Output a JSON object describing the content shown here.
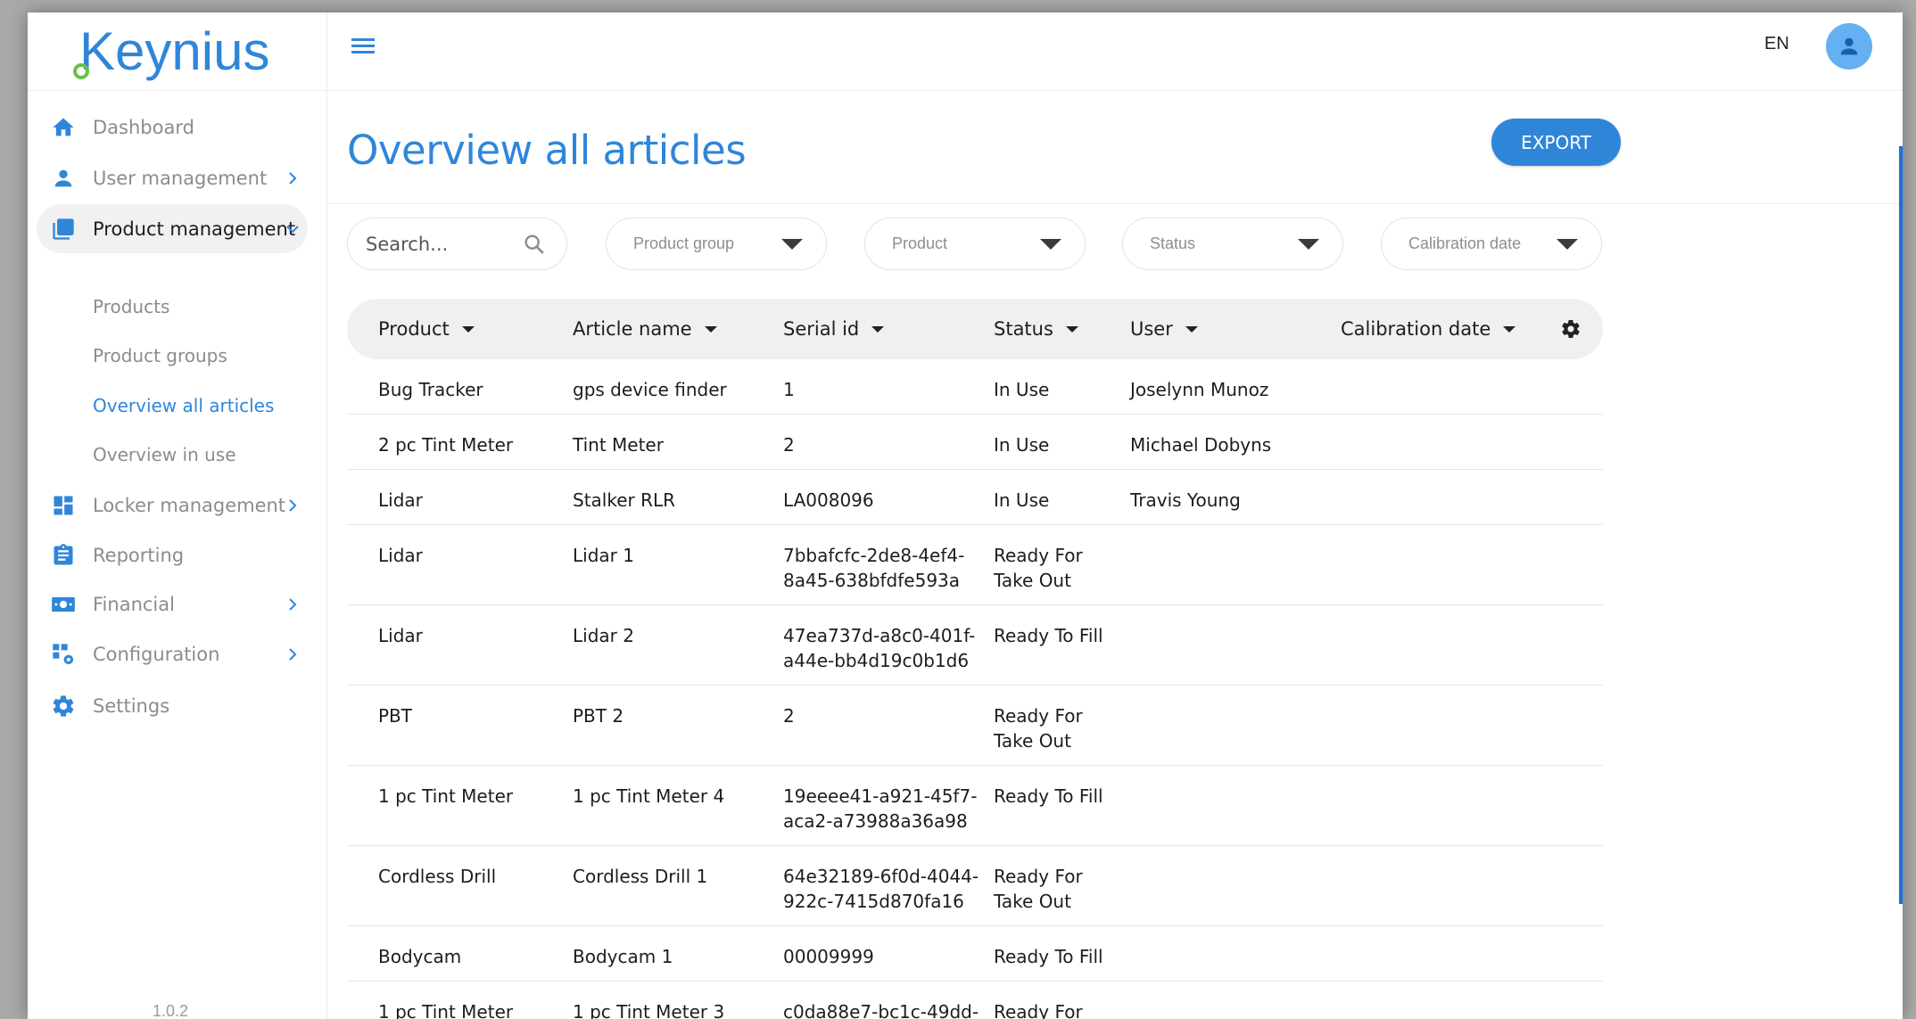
{
  "brand": {
    "logo_text": "Keynius",
    "colors": {
      "primary": "#2f86d9",
      "accent_green": "#6cc04a"
    }
  },
  "sidebar": {
    "items": [
      {
        "label": "Dashboard",
        "icon": "home-icon",
        "chevron": false
      },
      {
        "label": "User management",
        "icon": "user-icon",
        "chevron": true
      },
      {
        "label": "Product management",
        "icon": "library-icon",
        "chevron": true,
        "expanded": true
      },
      {
        "label": "Locker management",
        "icon": "grid-icon",
        "chevron": true
      },
      {
        "label": "Reporting",
        "icon": "clipboard-icon",
        "chevron": false
      },
      {
        "label": "Financial",
        "icon": "money-icon",
        "chevron": true
      },
      {
        "label": "Configuration",
        "icon": "config-icon",
        "chevron": true
      },
      {
        "label": "Settings",
        "icon": "gear-icon",
        "chevron": false
      }
    ],
    "sub_items": [
      "Products",
      "Product groups",
      "Overview all articles",
      "Overview in use"
    ],
    "version": "1.0.2"
  },
  "topbar": {
    "language": "EN"
  },
  "header": {
    "title": "Overview all articles",
    "export_label": "EXPORT"
  },
  "filters": {
    "search_placeholder": "Search...",
    "product_group": "Product group",
    "product": "Product",
    "status": "Status",
    "calibration_date": "Calibration date"
  },
  "table": {
    "columns": [
      "Product",
      "Article name",
      "Serial id",
      "Status",
      "User",
      "Calibration date"
    ],
    "rows": [
      {
        "product": "Bug Tracker",
        "article": "gps device finder",
        "serial": "1",
        "status": "In Use",
        "user": "Joselynn Munoz",
        "calibration": ""
      },
      {
        "product": "2 pc Tint Meter",
        "article": "Tint Meter",
        "serial": "2",
        "status": "In Use",
        "user": "Michael Dobyns",
        "calibration": ""
      },
      {
        "product": "Lidar",
        "article": "Stalker RLR",
        "serial": "LA008096",
        "status": "In Use",
        "user": "Travis Young",
        "calibration": ""
      },
      {
        "product": "Lidar",
        "article": "Lidar 1",
        "serial": "7bbafcfc-2de8-4ef4-\n8a45-638bfdfe593a",
        "status": "Ready For\nTake Out",
        "user": "",
        "calibration": ""
      },
      {
        "product": "Lidar",
        "article": "Lidar 2",
        "serial": "47ea737d-a8c0-401f-\na44e-bb4d19c0b1d6",
        "status": "Ready To Fill",
        "user": "",
        "calibration": ""
      },
      {
        "product": "PBT",
        "article": "PBT 2",
        "serial": "2",
        "status": "Ready For\nTake Out",
        "user": "",
        "calibration": ""
      },
      {
        "product": "1 pc Tint Meter",
        "article": "1 pc Tint Meter 4",
        "serial": "19eeee41-a921-45f7-\naca2-a73988a36a98",
        "status": "Ready To Fill",
        "user": "",
        "calibration": ""
      },
      {
        "product": "Cordless Drill",
        "article": "Cordless Drill 1",
        "serial": "64e32189-6f0d-4044-\n922c-7415d870fa16",
        "status": "Ready For\nTake Out",
        "user": "",
        "calibration": ""
      },
      {
        "product": "Bodycam",
        "article": "Bodycam 1",
        "serial": "00009999",
        "status": "Ready To Fill",
        "user": "",
        "calibration": ""
      },
      {
        "product": "1 pc Tint Meter",
        "article": "1 pc Tint Meter 3",
        "serial": "c0da88e7-bc1c-49dd-",
        "status": "Ready For",
        "user": "",
        "calibration": ""
      }
    ]
  }
}
